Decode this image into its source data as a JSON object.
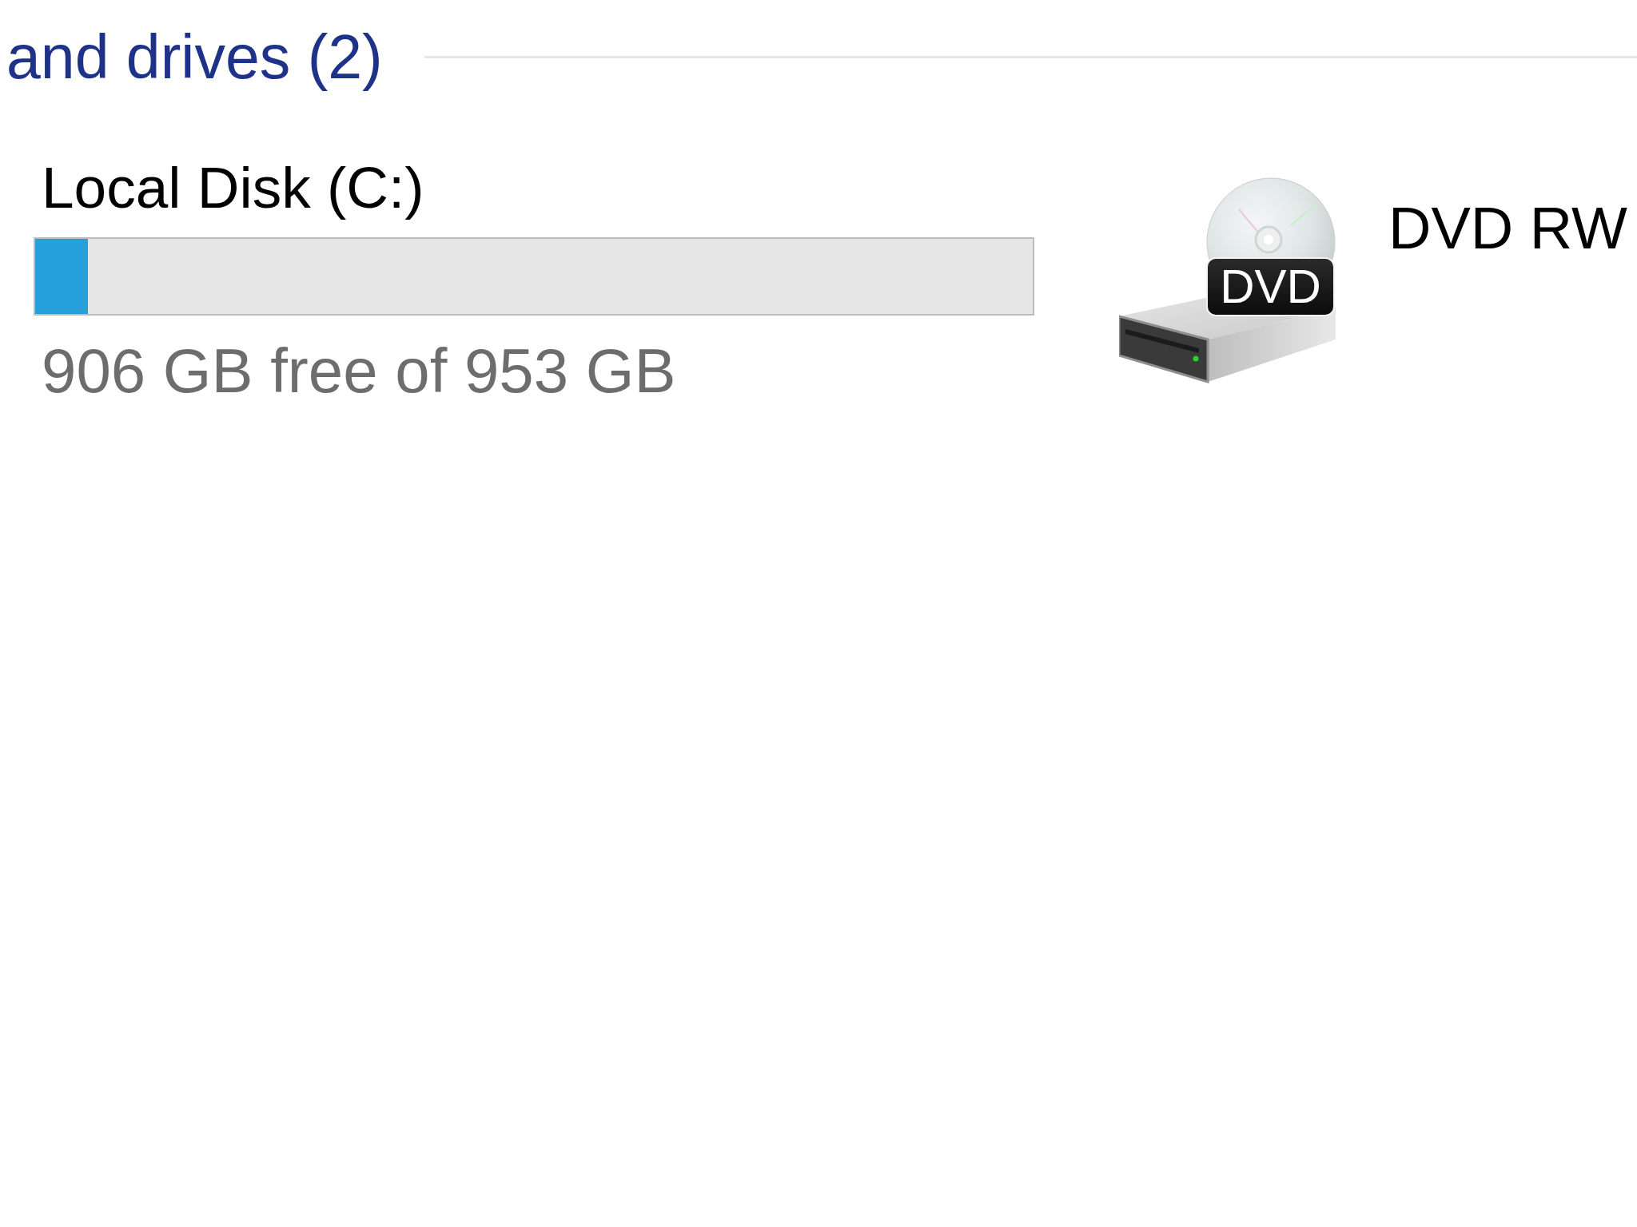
{
  "group_header": {
    "title": "and drives (2)"
  },
  "drives": [
    {
      "kind": "disk",
      "name": "Local Disk (C:)",
      "level": 0.053,
      "free_text": "906 GB free of 953 GB"
    },
    {
      "kind": "optical",
      "name": "DVD RW",
      "badge": "DVD"
    }
  ]
}
